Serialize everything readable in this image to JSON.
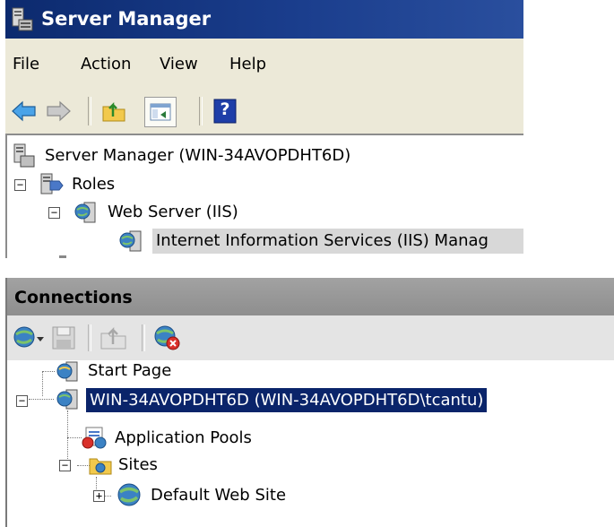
{
  "server_manager": {
    "title": "Server Manager",
    "menu": [
      "File",
      "Action",
      "View",
      "Help"
    ],
    "toolbar_icons": [
      "back-arrow-icon",
      "forward-arrow-icon",
      "up-folder-icon",
      "show-hide-tree-icon",
      "help-icon"
    ],
    "help_glyph": "?",
    "tree": {
      "root": "Server Manager (WIN-34AVOPDHT6D)",
      "roles": "Roles",
      "web_server": "Web Server (IIS)",
      "iis_manager": "Internet Information Services (IIS) Manag"
    }
  },
  "connections": {
    "header": "Connections",
    "toolbar_icons": [
      "connect-icon",
      "save-icon",
      "up-icon",
      "disconnect-icon"
    ],
    "tree": {
      "start_page": "Start Page",
      "server": "WIN-34AVOPDHT6D (WIN-34AVOPDHT6D\\tcantu)",
      "app_pools": "Application Pools",
      "sites": "Sites",
      "default_site": "Default Web Site"
    }
  },
  "colors": {
    "title_bar": "#0c2a6e",
    "selection": "#0a246a",
    "toolbar_bg": "#ece9d8"
  }
}
